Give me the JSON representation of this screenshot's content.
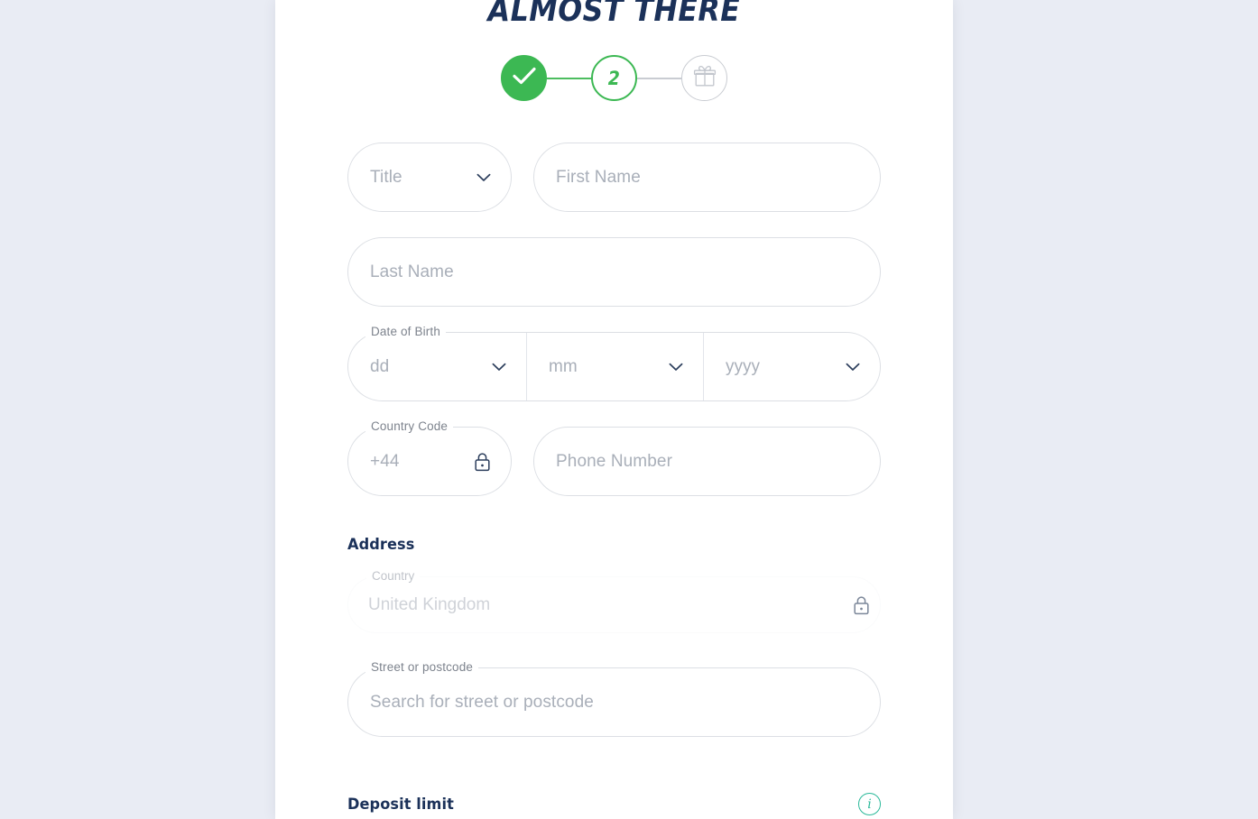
{
  "theme": {
    "page_bg": "#e9ecf4",
    "card_bg": "#ffffff",
    "navy": "#1b3159",
    "green": "#3cb853",
    "grey_border": "#dcdfe4",
    "placeholder": "#a9afb9",
    "teal": "#2bb99a"
  },
  "header": {
    "title": "ALMOST THERE"
  },
  "stepper": {
    "steps": [
      {
        "id": "step-1",
        "state": "done",
        "label": "",
        "icon": "check-icon"
      },
      {
        "id": "step-2",
        "state": "current",
        "label": "2",
        "icon": ""
      },
      {
        "id": "step-3",
        "state": "future",
        "label": "",
        "icon": "gift-icon"
      }
    ],
    "connectors": [
      {
        "state": "green"
      },
      {
        "state": "grey"
      }
    ]
  },
  "form": {
    "title_select": {
      "placeholder": "Title",
      "value": "",
      "icon": "chevron-down-icon"
    },
    "first_name": {
      "placeholder": "First Name",
      "value": ""
    },
    "last_name": {
      "placeholder": "Last Name",
      "value": ""
    },
    "date_of_birth": {
      "label": "Date of Birth",
      "day": {
        "placeholder": "dd",
        "value": "",
        "icon": "chevron-down-icon"
      },
      "month": {
        "placeholder": "mm",
        "value": "",
        "icon": "chevron-down-icon"
      },
      "year": {
        "placeholder": "yyyy",
        "value": "",
        "icon": "chevron-down-icon"
      }
    },
    "country_code": {
      "label": "Country Code",
      "value": "+44",
      "icon": "lock-icon",
      "locked": true
    },
    "phone_number": {
      "placeholder": "Phone Number",
      "value": ""
    },
    "address_heading": "Address",
    "country": {
      "label": "Country",
      "value": "United Kingdom",
      "icon": "lock-icon",
      "locked": true
    },
    "street_or_postcode": {
      "label": "Street or postcode",
      "placeholder": "Search for street or postcode",
      "value": ""
    },
    "deposit_limit": {
      "heading": "Deposit limit",
      "info_icon": "info-icon",
      "info_glyph": "i"
    }
  }
}
